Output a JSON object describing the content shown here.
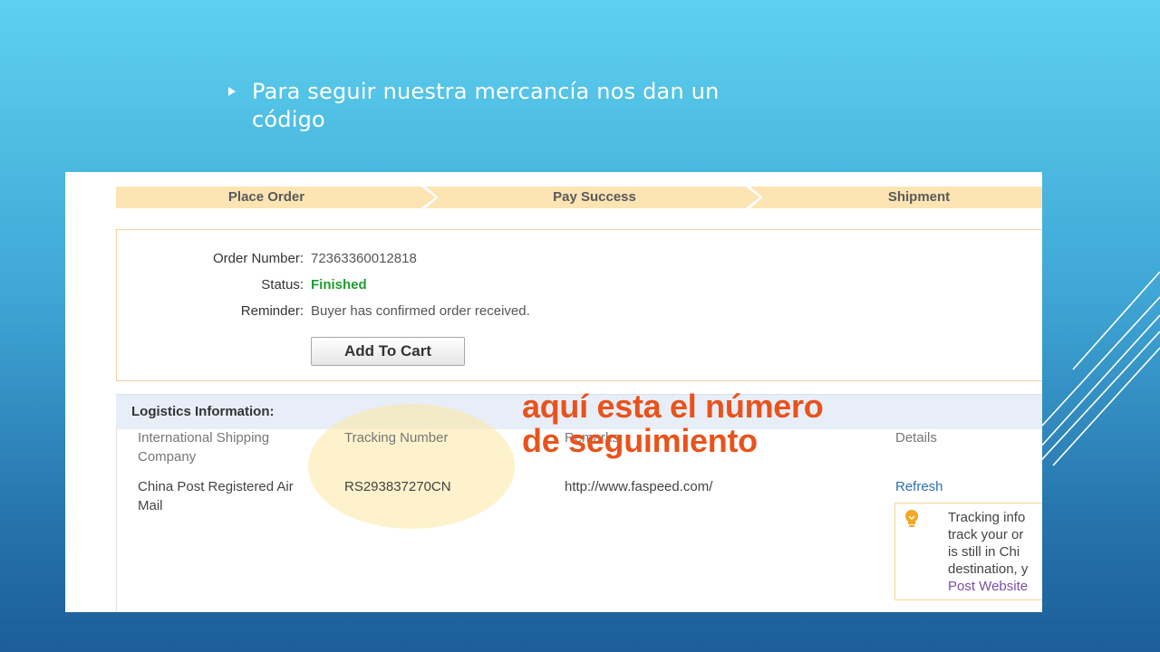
{
  "slide": {
    "bullet_text": "Para seguir nuestra mercancía nos dan un código"
  },
  "progress_steps": [
    "Place Order",
    "Pay Success",
    "Shipment"
  ],
  "order": {
    "order_number_label": "Order Number:",
    "order_number_value": "72363360012818",
    "status_label": "Status:",
    "status_value": "Finished",
    "reminder_label": "Reminder:",
    "reminder_value": "Buyer has confirmed order received.",
    "add_to_cart_label": "Add To Cart"
  },
  "logistics": {
    "title": "Logistics Information:",
    "columns": [
      "International Shipping Company",
      "Tracking Number",
      "Remarks",
      "Details"
    ],
    "row": {
      "company": "China Post Registered Air Mail",
      "tracking_number": "RS293837270CN",
      "remarks": "http://www.faspeed.com/",
      "details_link": "Refresh"
    },
    "tip_lines": [
      "Tracking info",
      "track your or",
      "is still in Chi",
      "destination, y"
    ],
    "tip_link": "Post Website"
  },
  "annotation": {
    "line1": "aquí esta el número",
    "line2": "de seguimiento"
  },
  "colors": {
    "status_green": "#1f9e2e",
    "annotation_orange": "#e8531c",
    "link_blue": "#2f6fb0",
    "progress_fill": "#fce4b3"
  },
  "icons": {
    "bullet": "triangle-bullet-icon",
    "tip": "lightbulb-icon"
  }
}
